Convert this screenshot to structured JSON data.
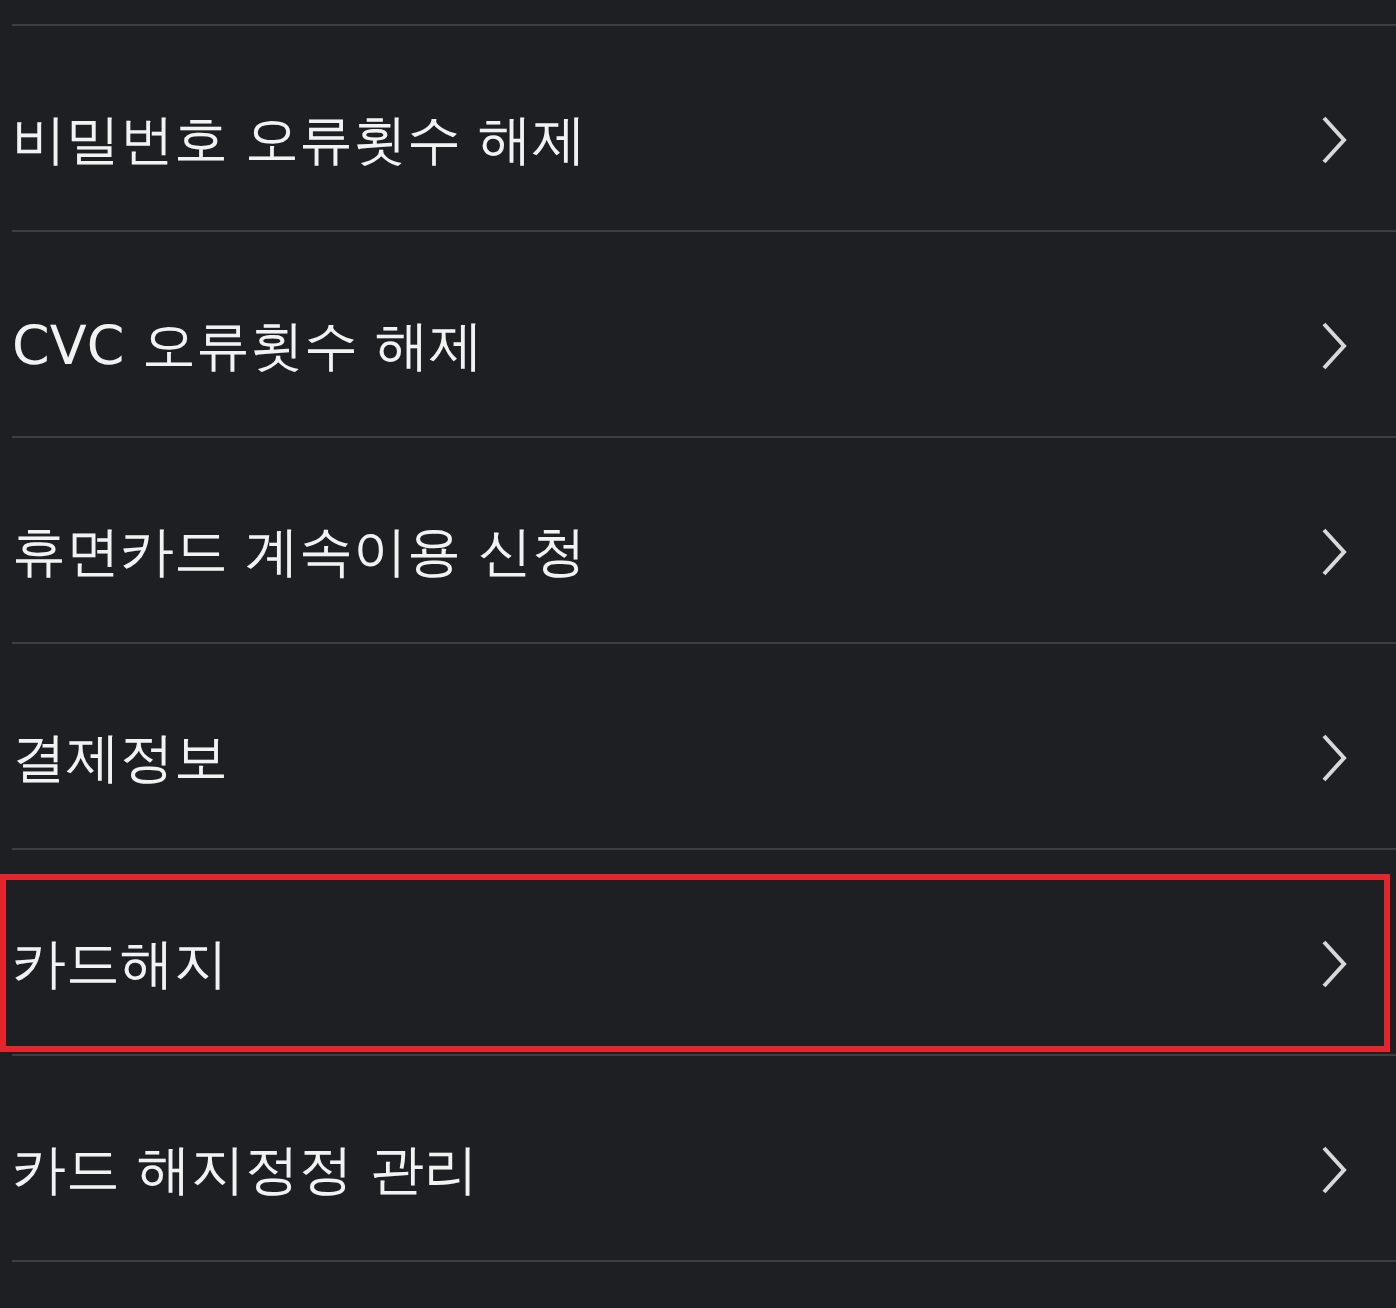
{
  "menu": {
    "items": [
      {
        "label": "비밀번호 오류횟수 해제",
        "highlighted": false
      },
      {
        "label": "CVC 오류횟수 해제",
        "highlighted": false
      },
      {
        "label": "휴면카드 계속이용 신청",
        "highlighted": false
      },
      {
        "label": "결제정보",
        "highlighted": false
      },
      {
        "label": "카드해지",
        "highlighted": true
      },
      {
        "label": "카드 해지정정 관리",
        "highlighted": false
      }
    ]
  }
}
